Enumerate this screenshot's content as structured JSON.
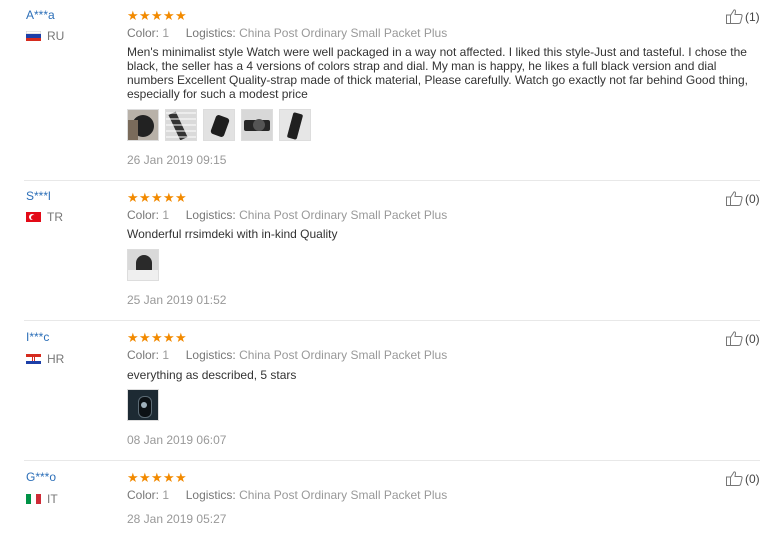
{
  "labels": {
    "color": "Color:",
    "logistics": "Logistics:"
  },
  "reviews": [
    {
      "user": "A***a",
      "country": "RU",
      "flag": [
        "#ffffff",
        "#1c3fa8",
        "#d52b1e"
      ],
      "color_value": "1",
      "logistics_value": "China Post Ordinary Small Packet Plus",
      "text": "Men's minimalist style Watch were well packaged in a way not affected. I liked this style-Just and tasteful. I chose the black, the seller has a 4 versions of colors strap and dial. My man is happy, he likes a full black version and dial numbers Excellent Quality-strap made of thick material, Please carefully. Watch go exactly not far behind Good thing, especially for such a modest price",
      "photo_count": 5,
      "date": "26 Jan 2019 09:15",
      "helpful": "(1)"
    },
    {
      "user": "S***l",
      "country": "TR",
      "flag": [
        "#e30a17"
      ],
      "color_value": "1",
      "logistics_value": "China Post Ordinary Small Packet Plus",
      "text": "Wonderful rrsimdeki with in-kind Quality",
      "photo_count": 1,
      "date": "25 Jan 2019 01:52",
      "helpful": "(0)"
    },
    {
      "user": "I***c",
      "country": "HR",
      "flag": [
        "#d52b1e",
        "#ffffff",
        "#1c3fa8"
      ],
      "color_value": "1",
      "logistics_value": "China Post Ordinary Small Packet Plus",
      "text": "everything as described, 5 stars",
      "photo_count": 1,
      "date": "08 Jan 2019 06:07",
      "helpful": "(0)"
    },
    {
      "user": "G***o",
      "country": "IT",
      "flag": [
        "#009246",
        "#ffffff",
        "#ce2b37"
      ],
      "color_value": "1",
      "logistics_value": "China Post Ordinary Small Packet Plus",
      "text": "",
      "photo_count": 0,
      "date": "28 Jan 2019 05:27",
      "helpful": "(0)"
    }
  ],
  "icons": {
    "star": "star-icon",
    "helpful": "thumbs-up-icon"
  },
  "accent_colors": {
    "star": "#f28a00",
    "user_link": "#2c6fb8"
  }
}
